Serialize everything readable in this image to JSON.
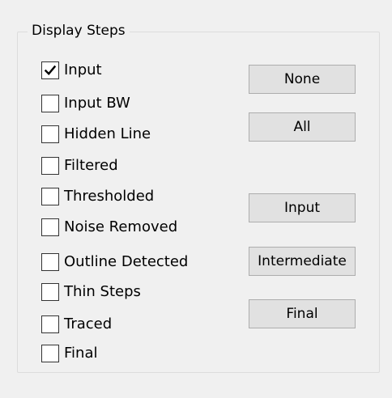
{
  "group": {
    "title": "Display Steps"
  },
  "checkboxes": [
    {
      "label": "Input",
      "checked": true
    },
    {
      "label": "Input BW",
      "checked": false
    },
    {
      "label": "Hidden Line",
      "checked": false
    },
    {
      "label": "Filtered",
      "checked": false
    },
    {
      "label": "Thresholded",
      "checked": false
    },
    {
      "label": "Noise Removed",
      "checked": false
    },
    {
      "label": "Outline Detected",
      "checked": false
    },
    {
      "label": "Thin Steps",
      "checked": false
    },
    {
      "label": "Traced",
      "checked": false
    },
    {
      "label": "Final",
      "checked": false
    }
  ],
  "buttons": {
    "none": "None",
    "all": "All",
    "input": "Input",
    "intermediate": "Intermediate",
    "final": "Final"
  }
}
